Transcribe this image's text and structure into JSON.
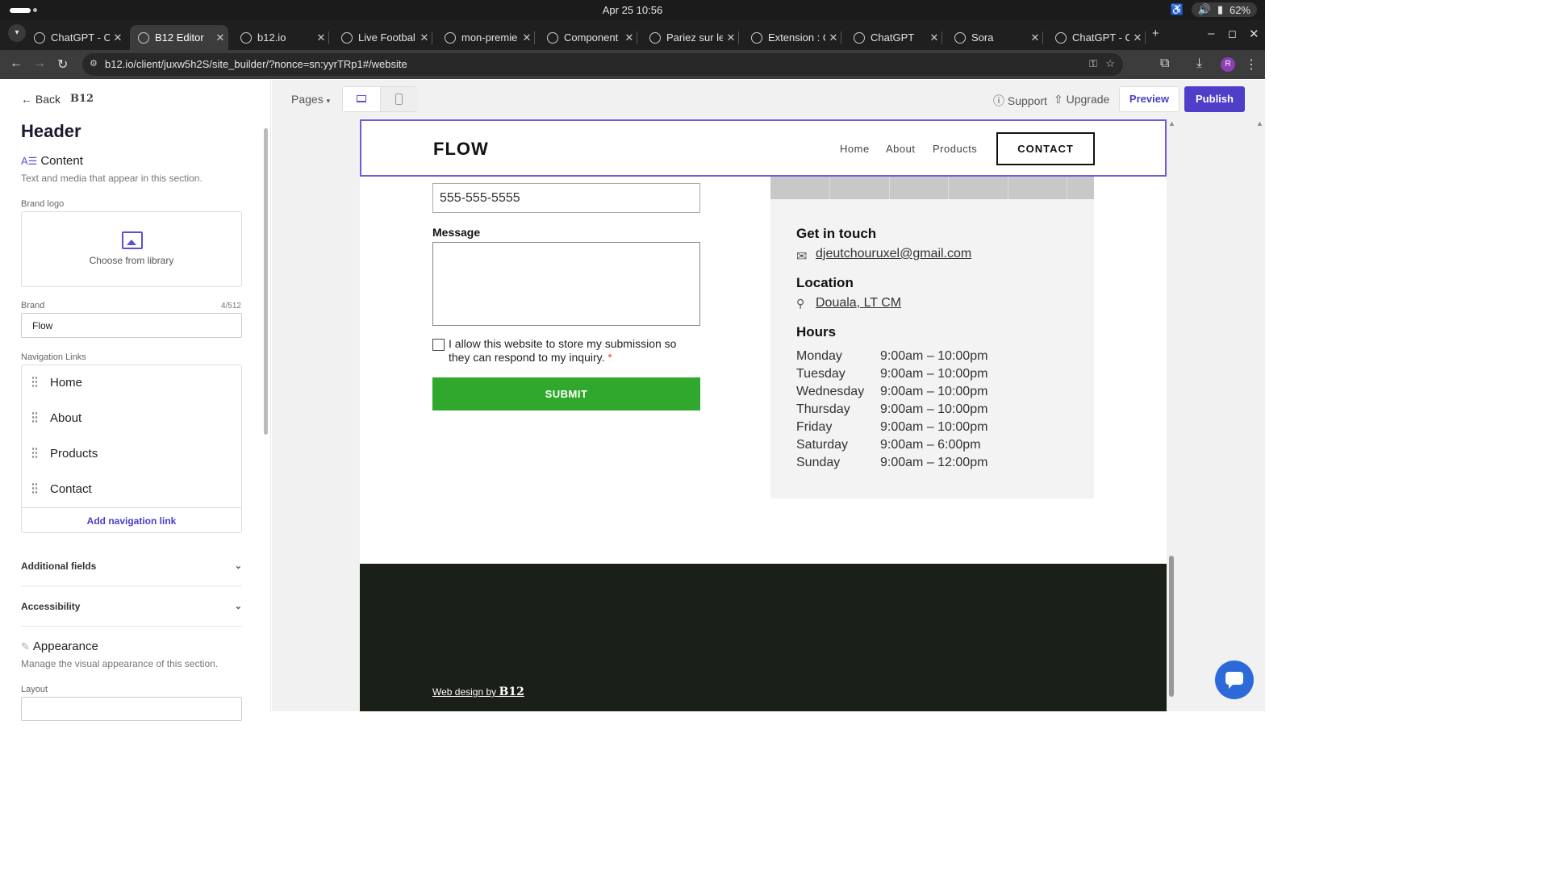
{
  "system_bar": {
    "clock": "Apr 25  10:56",
    "battery": "62%"
  },
  "browser": {
    "tabs": [
      {
        "title": "ChatGPT - C"
      },
      {
        "title": "B12 Editor"
      },
      {
        "title": "b12.io"
      },
      {
        "title": "Live Footbal"
      },
      {
        "title": "mon-premie"
      },
      {
        "title": "Component"
      },
      {
        "title": "Pariez sur le"
      },
      {
        "title": "Extension : C"
      },
      {
        "title": "ChatGPT"
      },
      {
        "title": "Sora"
      },
      {
        "title": "ChatGPT - C"
      }
    ],
    "new_tab": "+",
    "url": "b12.io/client/juxw5h2S/site_builder/?nonce=sn:yyrTRp1#/website",
    "profile_initial": "R"
  },
  "sidebar": {
    "back_label": "Back",
    "logo_text": "B12",
    "title": "Header",
    "content_section": {
      "title": "Content",
      "description": "Text and media that appear in this section."
    },
    "brand_logo_label": "Brand logo",
    "choose_library": "Choose from library",
    "brand_label": "Brand",
    "brand_count": "4/512",
    "brand_value": "Flow",
    "nav_links_label": "Navigation Links",
    "nav_links": [
      "Home",
      "About",
      "Products",
      "Contact"
    ],
    "add_nav_link": "Add navigation link",
    "additional_fields": "Additional fields",
    "accessibility": "Accessibility",
    "appearance_section": {
      "title": "Appearance",
      "description": "Manage the visual appearance of this section."
    },
    "layout_label": "Layout"
  },
  "toolbar": {
    "pages_label": "Pages",
    "support": "Support",
    "upgrade": "Upgrade",
    "preview": "Preview",
    "publish": "Publish"
  },
  "site": {
    "brand": "FLOW",
    "nav": [
      "Home",
      "About",
      "Products"
    ],
    "cta": "CONTACT",
    "form": {
      "phone_value": "555-555-5555",
      "message_label": "Message",
      "consent_text": "I allow this website to store my submission so they can respond to my inquiry.",
      "required_mark": "*",
      "submit_label": "SUBMIT"
    },
    "contact": {
      "get_in_touch": "Get in touch",
      "email": "djeutchouruxel@gmail.com",
      "location_title": "Location",
      "location": "Douala, LT CM",
      "hours_title": "Hours",
      "hours": [
        {
          "day": "Monday",
          "time": "9:00am  –  10:00pm"
        },
        {
          "day": "Tuesday",
          "time": "9:00am  –  10:00pm"
        },
        {
          "day": "Wednesday",
          "time": "9:00am  –  10:00pm"
        },
        {
          "day": "Thursday",
          "time": "9:00am  –  10:00pm"
        },
        {
          "day": "Friday",
          "time": "9:00am  –  10:00pm"
        },
        {
          "day": "Saturday",
          "time": "9:00am  –  6:00pm"
        },
        {
          "day": "Sunday",
          "time": "9:00am  –  12:00pm"
        }
      ]
    },
    "footer": {
      "credit_prefix": "Web design by",
      "credit_brand": "B12"
    }
  },
  "colors": {
    "accent": "#4f3fc8",
    "submit": "#30a82e",
    "footer_bg": "#1a2018",
    "selection": "#6b5fd8"
  }
}
